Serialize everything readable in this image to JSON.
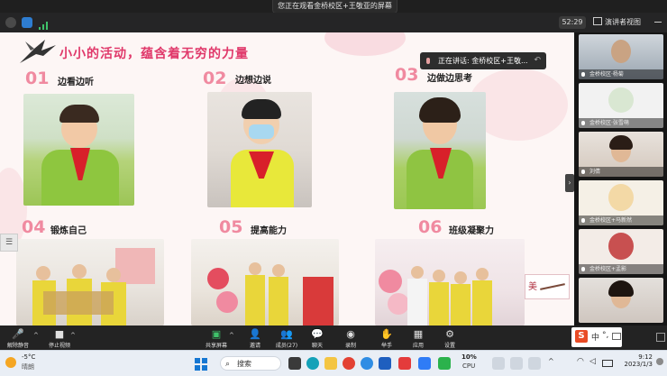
{
  "window": {
    "sharing_banner": "您正在观看金桥校区+王敬亚的屏幕",
    "timer": "52:29",
    "presenter_view": "演讲者视图"
  },
  "speaking": {
    "label": "正在讲话: 金桥校区+王敬..."
  },
  "slide": {
    "title": "小小的活动，蕴含着无穷的力量",
    "sections": [
      {
        "num": "01",
        "label": "边看边听"
      },
      {
        "num": "02",
        "label": "边想边说"
      },
      {
        "num": "03",
        "label": "边做边思考"
      },
      {
        "num": "04",
        "label": "锻炼自己"
      },
      {
        "num": "05",
        "label": "提高能力"
      },
      {
        "num": "06",
        "label": "班级凝聚力"
      }
    ],
    "stamp": "美"
  },
  "participants": [
    {
      "name": "金桥校区·杨菊"
    },
    {
      "name": "金桥校区·张雪萌"
    },
    {
      "name": "刘倩"
    },
    {
      "name": "金桥校区+马新然"
    },
    {
      "name": "金桥校区+孟影"
    },
    {
      "name": ""
    }
  ],
  "meeting_bar": {
    "mute": "解除静音",
    "stop_video": "停止视频",
    "share": "共享屏幕",
    "invite": "邀请",
    "members": "成员(27)",
    "chat": "聊天",
    "record": "录制",
    "raise_hand": "举手",
    "apps": "应用",
    "settings": "设置"
  },
  "ime": {
    "lang": "中"
  },
  "taskbar": {
    "weather_temp": "-5°C",
    "weather_desc": "晴朗",
    "search": "搜索",
    "cpu_value": "10%",
    "cpu_label": "CPU",
    "time": "9:12",
    "date": "2023/1/3"
  },
  "colors": {
    "accent_pink": "#e0386a",
    "number_pink": "#f08aa0",
    "win_blue": "#1677d2"
  }
}
